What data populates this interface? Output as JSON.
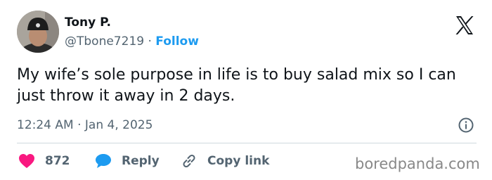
{
  "author": {
    "display_name": "Tony P.",
    "handle": "@Tbone7219",
    "separator": " · ",
    "follow_label": "Follow"
  },
  "tweet": {
    "text": "My wife’s sole purpose in life is to buy salad mix so I can just throw it away in 2 days.",
    "timestamp": "12:24 AM · Jan 4, 2025"
  },
  "actions": {
    "like_count": "872",
    "reply_label": "Reply",
    "copy_link_label": "Copy link"
  },
  "watermark": "boredpanda.com",
  "colors": {
    "link_blue": "#1d9bf0",
    "heart_red": "#f91880",
    "secondary_text": "#536471",
    "divider": "#cfd9de"
  },
  "icons": [
    "x-logo-icon",
    "info-icon",
    "heart-icon",
    "speech-bubble-icon",
    "link-icon"
  ]
}
